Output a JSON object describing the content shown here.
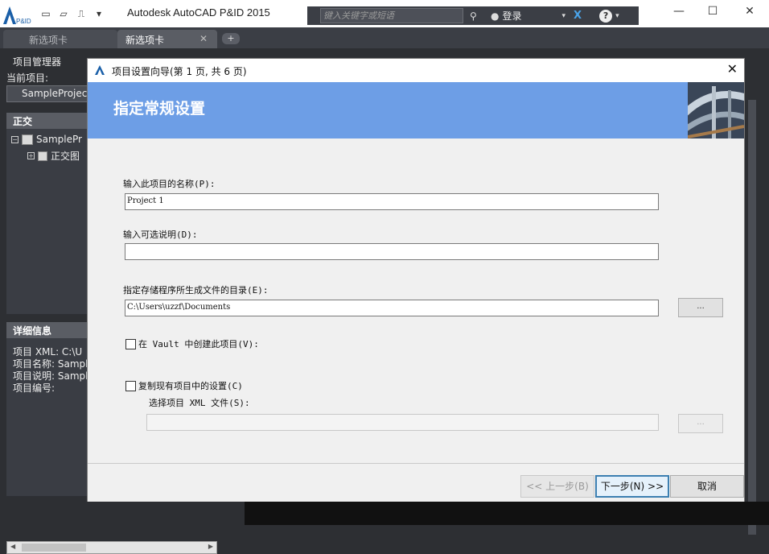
{
  "window": {
    "title": "Autodesk AutoCAD P&ID 2015",
    "logo_text": "P&ID",
    "search_placeholder": "键入关键字或短语",
    "login_label": "登录"
  },
  "tabs": [
    {
      "label": "新选项卡"
    },
    {
      "label": "新选项卡"
    }
  ],
  "palette": {
    "title": "项目管理器",
    "current_project_label": "当前项目:",
    "current_project_value": "SampleProject",
    "tree_header": "正交",
    "tree_items": [
      "SamplePr",
      "正交图"
    ],
    "details_header": "详细信息",
    "details": [
      "项目 XML:  C:\\U",
      "项目名称:  Sampl",
      "项目说明:  Sampl",
      "项目编号:"
    ]
  },
  "dialog": {
    "title": "项目设置向导(第 1 页, 共 6 页)",
    "banner_heading": "指定常规设置",
    "name_label": "输入此项目的名称(P):",
    "name_value": "Project 1",
    "desc_label": "输入可选说明(D):",
    "desc_value": "",
    "dir_label": "指定存储程序所生成文件的目录(E):",
    "dir_value": "C:\\Users\\uzzf\\Documents",
    "browse_label": "...",
    "vault_label": "在 Vault 中创建此项目(V):",
    "copy_label": "复制现有项目中的设置(C)",
    "xml_label": "选择项目 XML 文件(S):",
    "xml_value": "",
    "back_label": "<< 上一步(B)",
    "next_label": "下一步(N) >>",
    "cancel_label": "取消"
  }
}
